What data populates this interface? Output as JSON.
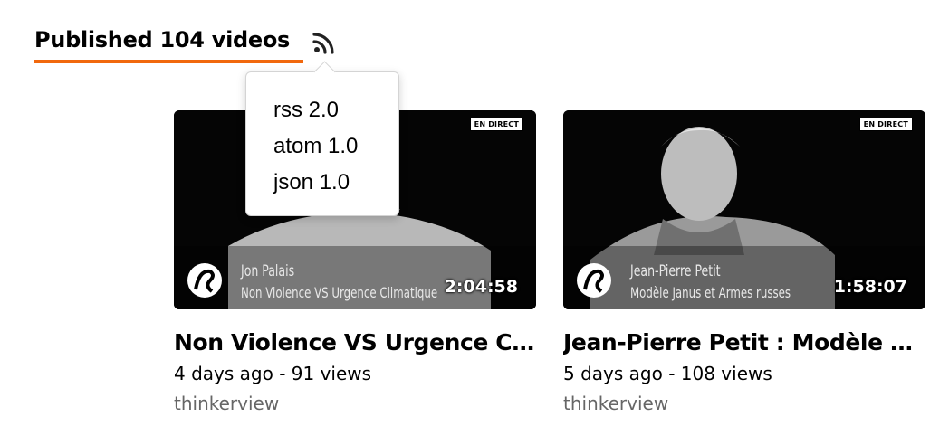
{
  "header": {
    "title": "Published 104 videos",
    "accent_color": "#f1680d",
    "feed_icon": "rss-icon"
  },
  "feed_menu": {
    "items": [
      "rss 2.0",
      "atom 1.0",
      "json 1.0"
    ]
  },
  "videos": [
    {
      "title": "Non Violence VS Urgence C…",
      "age": "4 days ago",
      "views": "91 views",
      "meta": "4 days ago - 91 views",
      "channel": "thinkerview",
      "duration": "2:04:58",
      "badge": "EN DIRECT",
      "overlay_name": "Jon Palais",
      "overlay_subtitle": "Non Violence VS Urgence Climatique"
    },
    {
      "title": "Jean-Pierre Petit : Modèle …",
      "age": "5 days ago",
      "views": "108 views",
      "meta": "5 days ago - 108 views",
      "channel": "thinkerview",
      "duration": "1:58:07",
      "badge": "EN DIRECT",
      "overlay_name": "Jean-Pierre Petit",
      "overlay_subtitle": "Modèle Janus et Armes russes"
    }
  ]
}
